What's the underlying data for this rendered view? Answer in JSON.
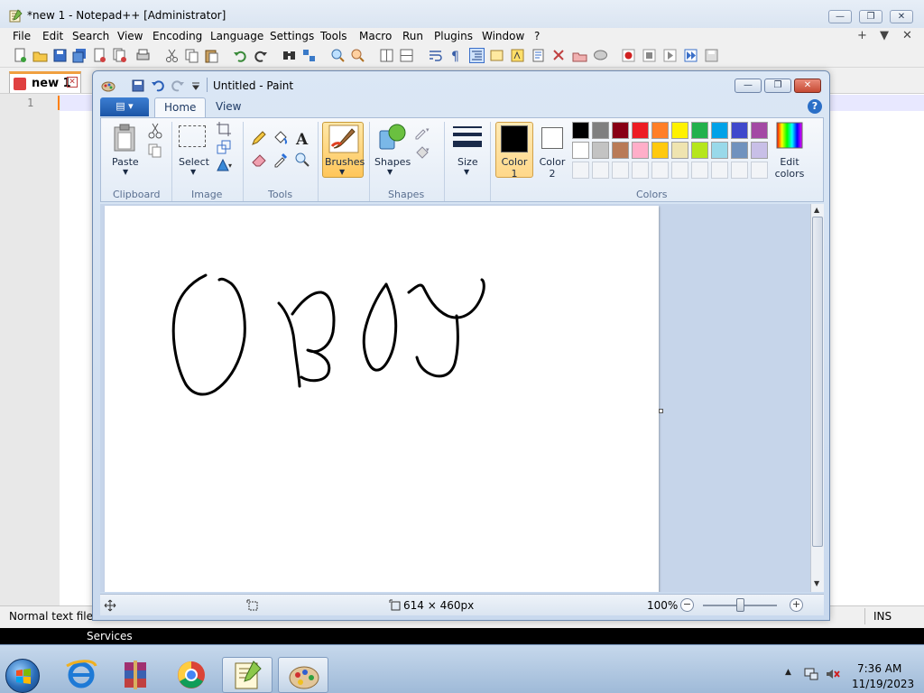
{
  "notepad": {
    "title": "*new 1 - Notepad++ [Administrator]",
    "menu": [
      "File",
      "Edit",
      "Search",
      "View",
      "Encoding",
      "Language",
      "Settings",
      "Tools",
      "Macro",
      "Run",
      "Plugins",
      "Window",
      "?"
    ],
    "menu_right": [
      "+",
      "▼",
      "✕"
    ],
    "tab_label": "new 1",
    "line_number": "1",
    "status_type": "Normal text file",
    "status_ins": "INS"
  },
  "paint": {
    "title": "Untitled - Paint",
    "tabs": [
      "Home",
      "View"
    ],
    "groups": {
      "clipboard": "Clipboard",
      "image": "Image",
      "tools": "Tools",
      "shapes": "Shapes",
      "colors": "Colors"
    },
    "buttons": {
      "paste": "Paste",
      "select": "Select",
      "brushes": "Brushes",
      "shapes": "Shapes",
      "size": "Size",
      "color1_line1": "Color",
      "color1_line2": "1",
      "color2_line1": "Color",
      "color2_line2": "2",
      "edit_colors_line1": "Edit",
      "edit_colors_line2": "colors"
    },
    "color1": "#000000",
    "color2": "#ffffff",
    "palette_row1": [
      "#000000",
      "#7f7f7f",
      "#880015",
      "#ed1c24",
      "#ff7f27",
      "#fff200",
      "#22b14c",
      "#00a2e8",
      "#3f48cc",
      "#a349a4"
    ],
    "palette_row2": [
      "#ffffff",
      "#c3c3c3",
      "#b97a57",
      "#ffaec9",
      "#ffc90e",
      "#efe4b0",
      "#b5e61d",
      "#99d9ea",
      "#7092be",
      "#c8bfe7"
    ],
    "canvas_size": "614 × 460px",
    "zoom": "100%"
  },
  "services_label": "Services",
  "taskbar": {
    "apps": [
      "internet-explorer",
      "file-archive",
      "chrome",
      "notepad-plus-plus",
      "paint"
    ],
    "time": "7:36 AM",
    "date": "11/19/2023"
  }
}
